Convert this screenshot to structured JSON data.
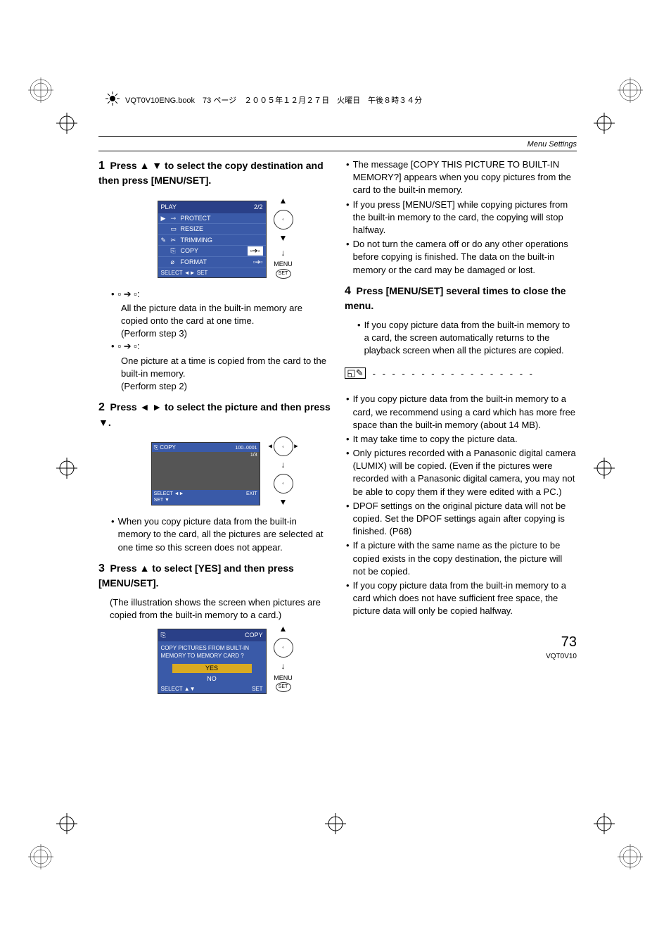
{
  "header": {
    "book_info": "VQT0V10ENG.book　73 ページ　２００５年１２月２７日　火曜日　午後８時３４分"
  },
  "section_title": "Menu Settings",
  "left_col": {
    "step1": {
      "num": "1",
      "title": "Press ▲ ▼ to select the copy destination and then press [MENU/SET].",
      "menu": {
        "header_left": "PLAY",
        "header_right": "2/2",
        "rows": [
          "PROTECT",
          "RESIZE",
          "TRIMMING",
          "COPY",
          "FORMAT"
        ],
        "footer": "SELECT ◄► SET"
      },
      "btn_label_menu": "MENU",
      "btn_label_set": "SET",
      "bullet1_intro": ":",
      "bullet1_text": "All the picture data in the built-in memory are copied onto the card at one time.",
      "bullet1_step": "(Perform step 3)",
      "bullet2_intro": ":",
      "bullet2_text": "One picture at a time is copied from the card to the built-in memory.",
      "bullet2_step": "(Perform step 2)"
    },
    "step2": {
      "num": "2",
      "title": "Press ◄ ► to select the picture and then press ▼.",
      "copy_label": "COPY",
      "meta1": "100–0001",
      "meta2": "1/3",
      "footer_left": "SELECT ◄►",
      "footer_left2": "SET ▼",
      "footer_right": "EXIT",
      "bullet": "When you copy picture data from the built-in memory to the card, all the pictures are selected at one time so this screen does not appear."
    },
    "step3": {
      "num": "3",
      "title": "Press ▲ to select [YES] and then press [MENU/SET].",
      "sub": "(The illustration shows the screen when pictures are copied from the built-in memory to a card.)",
      "confirm_header": "COPY",
      "confirm_msg": "COPY PICTURES FROM BUILT-IN MEMORY TO MEMORY CARD ?",
      "yes": "YES",
      "no": "NO",
      "footer_left": "SELECT ▲▼",
      "footer_right": "SET",
      "btn_label_menu": "MENU",
      "btn_label_set": "SET"
    }
  },
  "right_col": {
    "bullets1": [
      "The message [COPY THIS PICTURE TO BUILT-IN MEMORY?] appears when you copy pictures from the card to the built-in memory.",
      "If you press [MENU/SET] while copying pictures from the built-in memory to the card, the copying will stop halfway.",
      "Do not turn the camera off or do any other operations before copying is finished. The data on the built-in memory or the card may be damaged or lost."
    ],
    "step4": {
      "num": "4",
      "title": "Press [MENU/SET] several times to close the menu.",
      "bullet": "If you copy picture data from the built-in memory to a card, the screen automatically returns to the playback screen when all the pictures are copied."
    },
    "bullets2": [
      "If you copy picture data from the built-in memory to a card, we recommend using a card which has more free space than the built-in memory (about 14 MB).",
      "It may take time to copy the picture data.",
      "Only pictures recorded with a Panasonic digital camera (LUMIX) will be copied. (Even if the pictures were recorded with a Panasonic digital camera, you may not be able to copy them if they were edited with a PC.)",
      "DPOF settings on the original picture data will not be copied. Set the DPOF settings again after copying is finished. (P68)",
      "If a picture with the same name as the picture to be copied exists in the copy destination, the picture will not be copied.",
      "If you copy picture data from the built-in memory to a card which does not have sufficient free space, the picture data will only be copied halfway."
    ]
  },
  "page": {
    "num": "73",
    "code": "VQT0V10"
  }
}
